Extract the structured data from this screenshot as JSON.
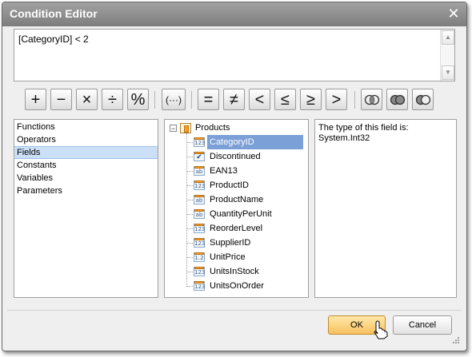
{
  "window": {
    "title": "Condition Editor"
  },
  "expression": {
    "text": "[CategoryID] < 2"
  },
  "operators": [
    {
      "symbol": "+",
      "name": "plus"
    },
    {
      "symbol": "−",
      "name": "minus"
    },
    {
      "symbol": "×",
      "name": "multiply"
    },
    {
      "symbol": "÷",
      "name": "divide"
    },
    {
      "symbol": "%",
      "name": "modulo"
    },
    {
      "symbol": "(···)",
      "name": "brackets"
    },
    {
      "symbol": "=",
      "name": "equal"
    },
    {
      "symbol": "≠",
      "name": "not-equal"
    },
    {
      "symbol": "<",
      "name": "less"
    },
    {
      "symbol": "≤",
      "name": "less-or-equal"
    },
    {
      "symbol": "≥",
      "name": "greater-or-equal"
    },
    {
      "symbol": ">",
      "name": "greater"
    }
  ],
  "categories": {
    "items": [
      "Functions",
      "Operators",
      "Fields",
      "Constants",
      "Variables",
      "Parameters"
    ],
    "selected": "Fields"
  },
  "fields_tree": {
    "root": "Products",
    "items": [
      {
        "name": "CategoryID",
        "icon": "123",
        "selected": true
      },
      {
        "name": "Discontinued",
        "icon": "check"
      },
      {
        "name": "EAN13",
        "icon": "ab"
      },
      {
        "name": "ProductID",
        "icon": "123"
      },
      {
        "name": "ProductName",
        "icon": "ab"
      },
      {
        "name": "QuantityPerUnit",
        "icon": "ab"
      },
      {
        "name": "ReorderLevel",
        "icon": "123"
      },
      {
        "name": "SupplierID",
        "icon": "123"
      },
      {
        "name": "UnitPrice",
        "icon": "1.2"
      },
      {
        "name": "UnitsInStock",
        "icon": "123"
      },
      {
        "name": "UnitsOnOrder",
        "icon": "123"
      }
    ]
  },
  "description": {
    "line1": "The type of this field is:",
    "line2": "System.Int32"
  },
  "buttons": {
    "ok": "OK",
    "cancel": "Cancel"
  },
  "colors": {
    "accent": "#f8c060",
    "selection": "#7b9fd7",
    "title_bar": "#8f8f8f"
  }
}
